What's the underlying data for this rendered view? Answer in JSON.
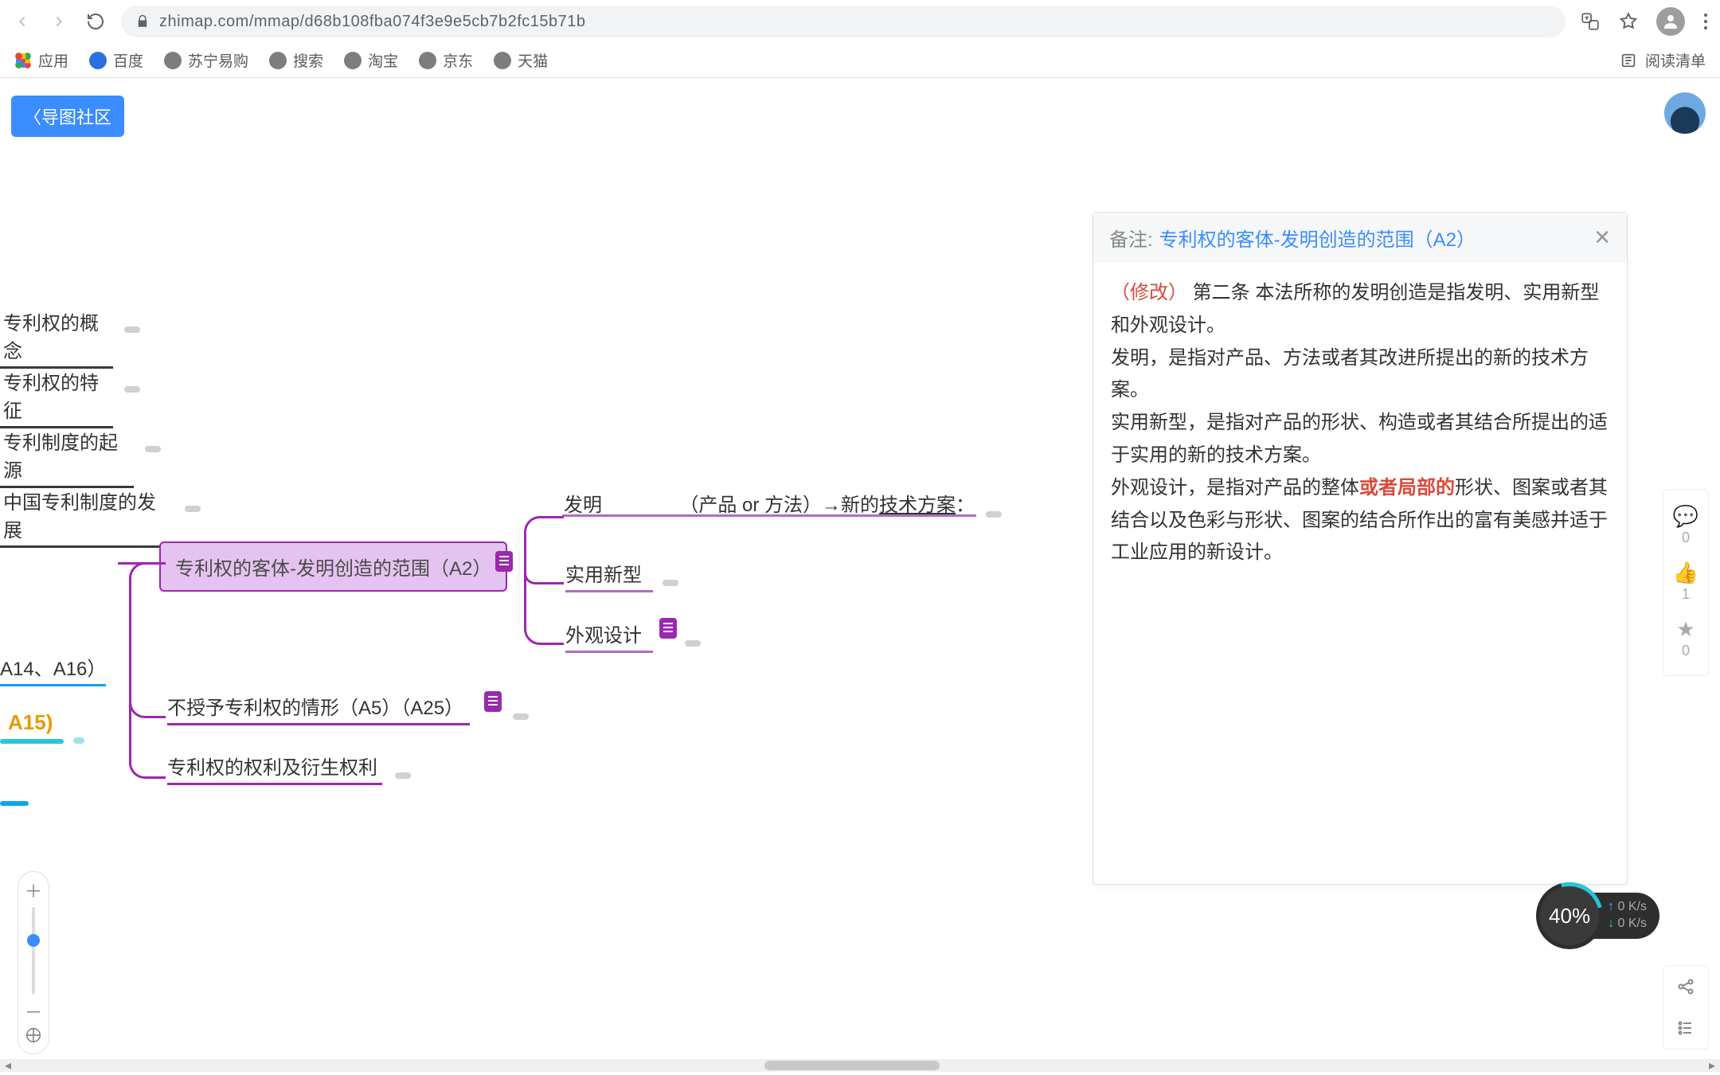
{
  "browser": {
    "url": "zhimap.com/mmap/d68b108fba074f3e9e5cb7b2fc15b71b",
    "reading_list": "阅读清单"
  },
  "bookmarks": {
    "apps": "应用",
    "items": [
      "百度",
      "苏宁易购",
      "搜索",
      "淘宝",
      "京东",
      "天猫"
    ]
  },
  "app": {
    "back_btn": "〈导图社区"
  },
  "mindmap": {
    "nodes": {
      "n1": "专利权的概念",
      "n2": "专利权的特征",
      "n3": "专利制度的起源",
      "n4": "中国专利制度的发展",
      "selected": "专利权的客体-发明创造的范围（A2）",
      "n5": "不授予专利权的情形（A5）（A25）",
      "n6": "专利权的权利及衍生权利",
      "c1_pre": "发明",
      "c1_mid": "（产品 or 方法）→新的",
      "c1_u": "技术方案",
      "c1_suf": "：",
      "c2": "实用新型",
      "c3": "外观设计",
      "left_tag": "A14、A16）",
      "a15": "A15)"
    }
  },
  "notes": {
    "prefix": "备注:",
    "title": "专利权的客体-发明创造的范围（A2）",
    "mod": "（修改）",
    "p1_a": "第二条 本法所称的发明创造是指发明、实用新型和外观设计。",
    "p2": "发明，是指对产品、方法或者其改进所提出的新的技术方案。",
    "p3": "实用新型，是指对产品的形状、构造或者其结合所提出的适于实用的新的技术方案。",
    "p4_a": "外观设计，是指对产品的整体",
    "p4_red": "或者局部的",
    "p4_b": "形状、图案或者其结合以及色彩与形状、图案的结合所作出的富有美感并适于工业应用的新设计。"
  },
  "rail": {
    "comment_count": "0",
    "like_count": "1",
    "star_count": "0"
  },
  "net": {
    "percent": "40%",
    "up": "0 K/s",
    "down": "0 K/s"
  }
}
